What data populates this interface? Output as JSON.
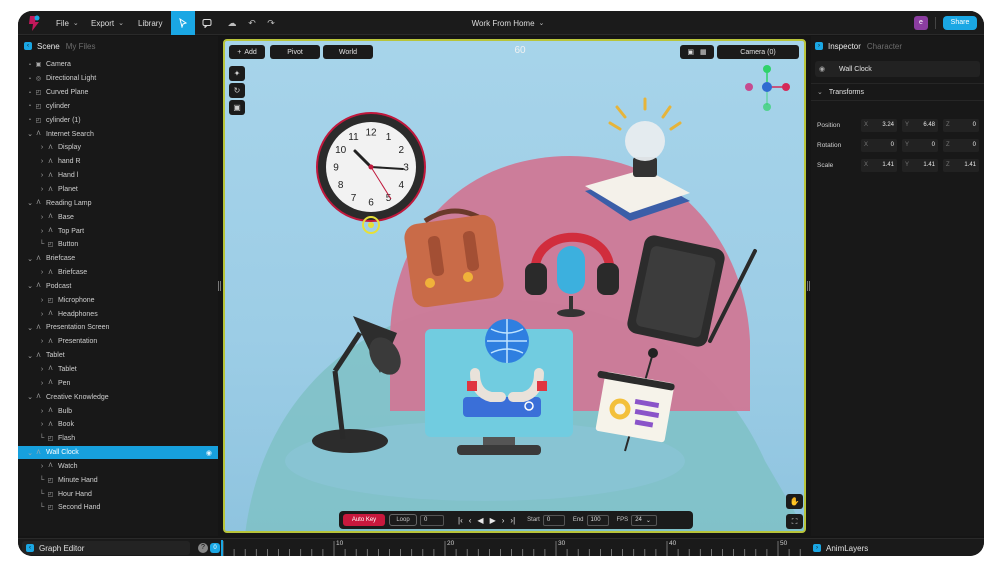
{
  "topbar": {
    "menu": [
      {
        "label": "File",
        "has_dropdown": true
      },
      {
        "label": "Export",
        "has_dropdown": true
      },
      {
        "label": "Library",
        "has_dropdown": false
      }
    ],
    "tool_icons": [
      "select-arrow-icon",
      "comment-icon",
      "cloud-icon",
      "undo-icon",
      "redo-icon"
    ],
    "project_title": "Work From Home",
    "avatar_initial": "e",
    "share_label": "Share",
    "accent_color": "#1aa7e4"
  },
  "scene_panel": {
    "tab_active": "Scene",
    "tab_inactive": "My Files",
    "items": [
      {
        "label": "Camera",
        "depth": 0,
        "toggle": "none",
        "icon": "camera-icon"
      },
      {
        "label": "Directional Light",
        "depth": 0,
        "toggle": "none",
        "icon": "light-icon"
      },
      {
        "label": "Curved Plane",
        "depth": 0,
        "toggle": "none",
        "icon": "mesh-icon"
      },
      {
        "label": "cylinder",
        "depth": 0,
        "toggle": "none",
        "icon": "mesh-icon"
      },
      {
        "label": "cylinder (1)",
        "depth": 0,
        "toggle": "none",
        "icon": "mesh-icon"
      },
      {
        "label": "Internet Search",
        "depth": 0,
        "toggle": "expanded",
        "icon": "group-icon"
      },
      {
        "label": "Display",
        "depth": 1,
        "toggle": "collapsed",
        "icon": "group-icon"
      },
      {
        "label": "hand R",
        "depth": 1,
        "toggle": "collapsed",
        "icon": "group-icon"
      },
      {
        "label": "Hand l",
        "depth": 1,
        "toggle": "collapsed",
        "icon": "group-icon"
      },
      {
        "label": "Planet",
        "depth": 1,
        "toggle": "collapsed",
        "icon": "group-icon"
      },
      {
        "label": "Reading Lamp",
        "depth": 0,
        "toggle": "expanded",
        "icon": "group-icon"
      },
      {
        "label": "Base",
        "depth": 1,
        "toggle": "collapsed",
        "icon": "group-icon"
      },
      {
        "label": "Top Part",
        "depth": 1,
        "toggle": "collapsed",
        "icon": "group-icon"
      },
      {
        "label": "Button",
        "depth": 1,
        "toggle": "leaf",
        "icon": "mesh-icon"
      },
      {
        "label": "Briefcase",
        "depth": 0,
        "toggle": "expanded",
        "icon": "group-icon"
      },
      {
        "label": "Briefcase",
        "depth": 1,
        "toggle": "collapsed",
        "icon": "group-icon"
      },
      {
        "label": "Podcast",
        "depth": 0,
        "toggle": "expanded",
        "icon": "group-icon"
      },
      {
        "label": "Microphone",
        "depth": 1,
        "toggle": "collapsed",
        "icon": "mesh-icon"
      },
      {
        "label": "Headphones",
        "depth": 1,
        "toggle": "collapsed",
        "icon": "group-icon"
      },
      {
        "label": "Presentation Screen",
        "depth": 0,
        "toggle": "expanded",
        "icon": "group-icon"
      },
      {
        "label": "Presentation",
        "depth": 1,
        "toggle": "collapsed",
        "icon": "group-icon"
      },
      {
        "label": "Tablet",
        "depth": 0,
        "toggle": "expanded",
        "icon": "group-icon"
      },
      {
        "label": "Tablet",
        "depth": 1,
        "toggle": "collapsed",
        "icon": "group-icon"
      },
      {
        "label": "Pen",
        "depth": 1,
        "toggle": "collapsed",
        "icon": "group-icon"
      },
      {
        "label": "Creative Knowledge",
        "depth": 0,
        "toggle": "expanded",
        "icon": "group-icon"
      },
      {
        "label": "Bulb",
        "depth": 1,
        "toggle": "collapsed",
        "icon": "group-icon"
      },
      {
        "label": "Book",
        "depth": 1,
        "toggle": "collapsed",
        "icon": "group-icon"
      },
      {
        "label": "Flash",
        "depth": 1,
        "toggle": "leaf",
        "icon": "mesh-icon"
      },
      {
        "label": "Wall Clock",
        "depth": 0,
        "toggle": "expanded",
        "icon": "group-icon",
        "selected": true
      },
      {
        "label": "Watch",
        "depth": 1,
        "toggle": "collapsed",
        "icon": "group-icon"
      },
      {
        "label": "Minute Hand",
        "depth": 1,
        "toggle": "leaf",
        "icon": "mesh-icon"
      },
      {
        "label": "Hour Hand",
        "depth": 1,
        "toggle": "leaf",
        "icon": "mesh-icon"
      },
      {
        "label": "Second Hand",
        "depth": 1,
        "toggle": "leaf",
        "icon": "mesh-icon"
      }
    ]
  },
  "viewport": {
    "add_label": "Add",
    "pivot_label": "Pivot",
    "world_label": "World",
    "fps_value": "60",
    "camera_label": "Camera (0)",
    "selection_border_color": "#b8c43a",
    "clock_numbers": [
      "12",
      "1",
      "2",
      "3",
      "4",
      "5",
      "6",
      "7",
      "8",
      "9",
      "10",
      "11"
    ]
  },
  "playback": {
    "auto_key_label": "Auto Key",
    "loop_label": "Loop",
    "current_frame": "0",
    "start_label": "Start",
    "start_value": "0",
    "end_label": "End",
    "end_value": "100",
    "fps_label": "FPS",
    "fps_value": "24"
  },
  "inspector": {
    "tab_active": "Inspector",
    "tab_inactive": "Character",
    "object_name": "Wall Clock",
    "section_title": "Transforms",
    "rows": [
      {
        "label": "Position",
        "x": "3.24",
        "y": "6.48",
        "z": "0"
      },
      {
        "label": "Rotation",
        "x": "0",
        "y": "0",
        "z": "0"
      },
      {
        "label": "Scale",
        "x": "1.41",
        "y": "1.41",
        "z": "1.41"
      }
    ]
  },
  "bottom": {
    "graph_editor_label": "Graph Editor",
    "help_label": "?",
    "timeline_start": "0",
    "timeline_ticks": [
      "10",
      "20",
      "30",
      "40",
      "50"
    ],
    "animlayers_label": "AnimLayers"
  }
}
